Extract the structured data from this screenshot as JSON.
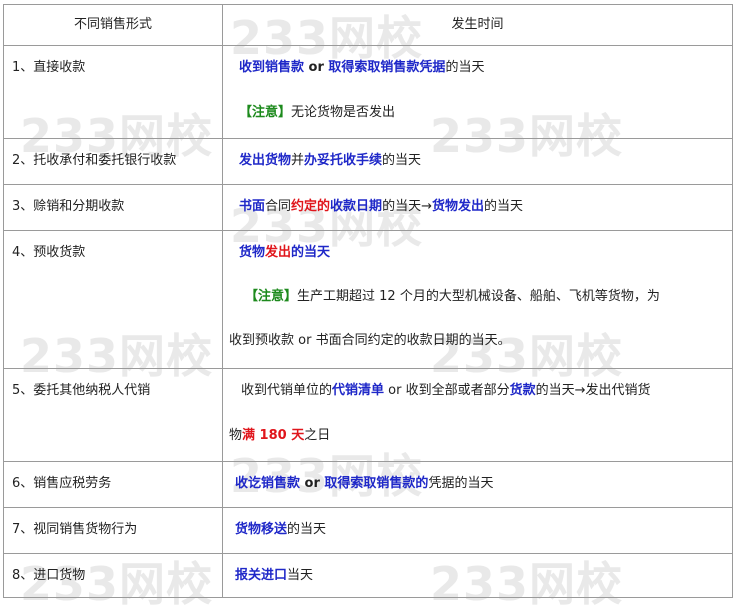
{
  "header": {
    "col1": "不同销售形式",
    "col2": "发生时间"
  },
  "rows": [
    {
      "type": "1、直接收款",
      "l1": {
        "a": "收到销售款",
        "b": " or ",
        "c": "取得索取销售款凭据",
        "d": "的当天"
      },
      "note": {
        "tag": "【注意】",
        "text": "无论货物是否发出"
      }
    },
    {
      "type": "2、托收承付和委托银行收款",
      "parts": {
        "a": "发出货物",
        "b": "并",
        "c": "办妥托收手续",
        "d": "的当天"
      }
    },
    {
      "type": "3、赊销和分期收款",
      "parts": {
        "a": "书面",
        "b": "合同",
        "c": "约定的",
        "d": "收款日期",
        "e": "的当天→",
        "f": "货物发出",
        "g": "的当天"
      }
    },
    {
      "type": "4、预收货款",
      "l1": {
        "a": "货物",
        "b": "发出",
        "c": "的当天"
      },
      "note": {
        "tag": "【注意】",
        "text": "生产工期超过 12 个月的大型机械设备、船舶、飞机等货物，为",
        "text2": "收到预收款 or 书面合同约定的收款日期的当天。"
      }
    },
    {
      "type": "5、委托其他纳税人代销",
      "parts": {
        "a": "收到代销单位的",
        "b": "代销清单",
        "c": " or 收到全部或者部分",
        "d": "货款",
        "e": "的当天→发出代销货",
        "f": "物",
        "g": "满 180 天",
        "h": "之日"
      }
    },
    {
      "type": "6、销售应税劳务",
      "parts": {
        "a": "收讫销售款",
        "b": " or ",
        "c": "取得索取销售款的",
        "d": "凭据的当天"
      }
    },
    {
      "type": "7、视同销售货物行为",
      "parts": {
        "a": "货物移送",
        "b": "的当天"
      }
    },
    {
      "type": "8、进口货物",
      "parts": {
        "a": "报关进口",
        "b": "当天"
      }
    }
  ],
  "watermark": "233网校"
}
